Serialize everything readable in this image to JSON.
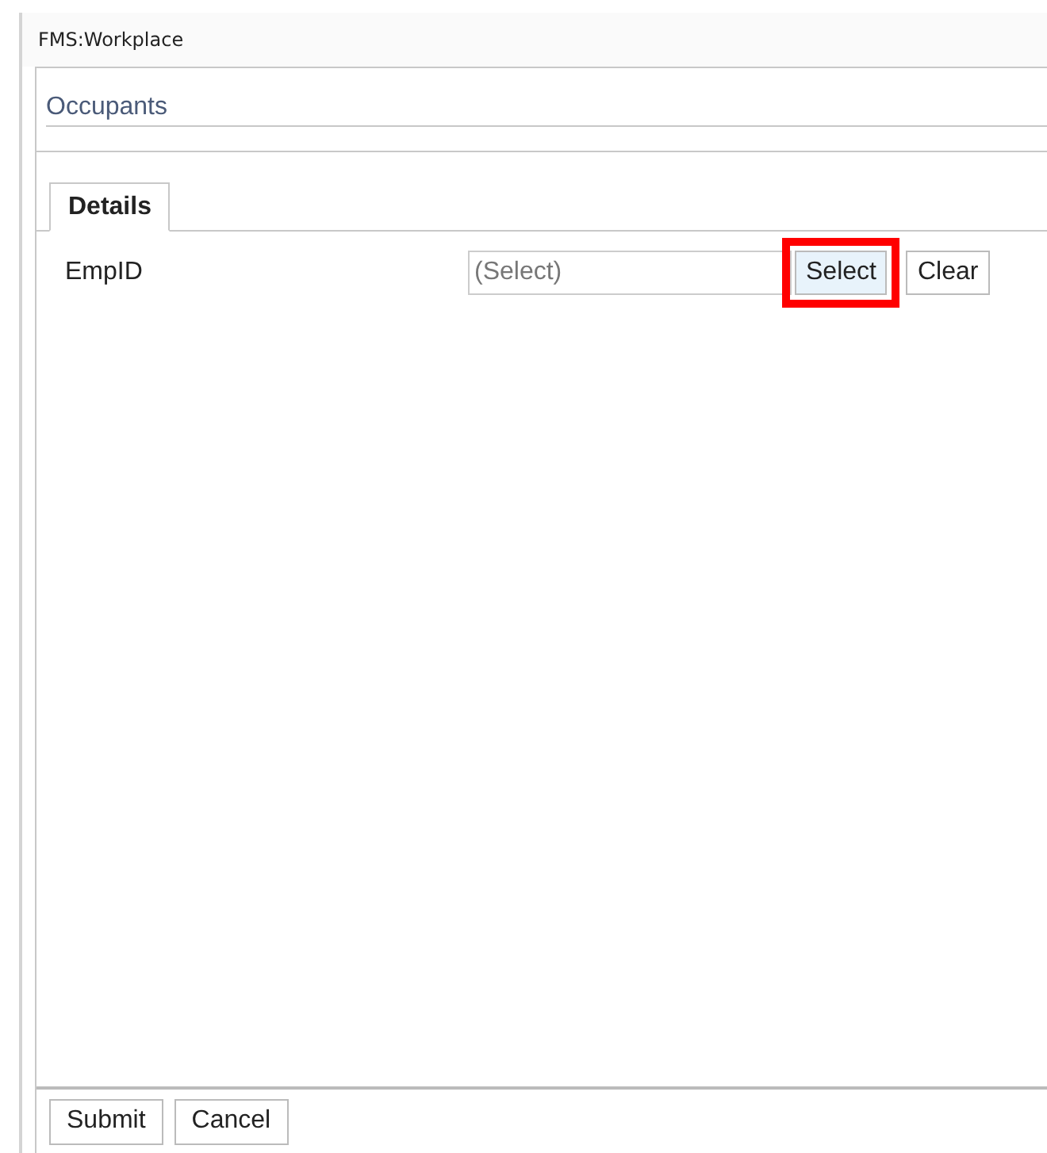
{
  "window": {
    "title": "FMS:Workplace"
  },
  "section": {
    "title": "Occupants"
  },
  "tabs": [
    {
      "label": "Details",
      "selected": true
    }
  ],
  "fields": [
    {
      "label": "EmpID",
      "placeholder": "(Select)",
      "buttons": [
        {
          "label": "Select",
          "highlighted": true
        },
        {
          "label": "Clear",
          "highlighted": false
        }
      ]
    }
  ],
  "buttons": [
    "Submit",
    "Cancel"
  ]
}
